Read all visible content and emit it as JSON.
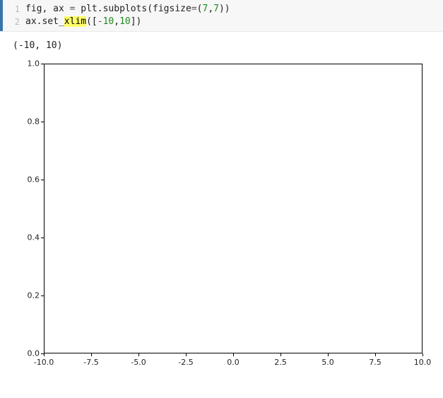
{
  "code": {
    "line_numbers": [
      "1",
      "2"
    ],
    "line1": {
      "t1": "fig, ax ",
      "op1": "=",
      "t2": " plt.subplots(figsize",
      "op2": "=",
      "t3": "(",
      "n1": "7",
      "t4": ",",
      "n2": "7",
      "t5": "))"
    },
    "line2": {
      "t1": "ax.set_",
      "hl": "xlim",
      "t2": "([",
      "op1": "-",
      "n1": "10",
      "t3": ",",
      "n2": "10",
      "t4": "])"
    }
  },
  "output": {
    "text": "(-10, 10)"
  },
  "chart_data": {
    "type": "line",
    "title": "",
    "xlabel": "",
    "ylabel": "",
    "xlim": [
      -10,
      10
    ],
    "ylim": [
      0,
      1
    ],
    "xticks": [
      -10.0,
      -7.5,
      -5.0,
      -2.5,
      0.0,
      2.5,
      5.0,
      7.5,
      10.0
    ],
    "xtick_labels": [
      "-10.0",
      "-7.5",
      "-5.0",
      "-2.5",
      "0.0",
      "2.5",
      "5.0",
      "7.5",
      "10.0"
    ],
    "yticks": [
      0.0,
      0.2,
      0.4,
      0.6,
      0.8,
      1.0
    ],
    "ytick_labels": [
      "0.0",
      "0.2",
      "0.4",
      "0.6",
      "0.8",
      "1.0"
    ],
    "grid": false,
    "series": []
  }
}
